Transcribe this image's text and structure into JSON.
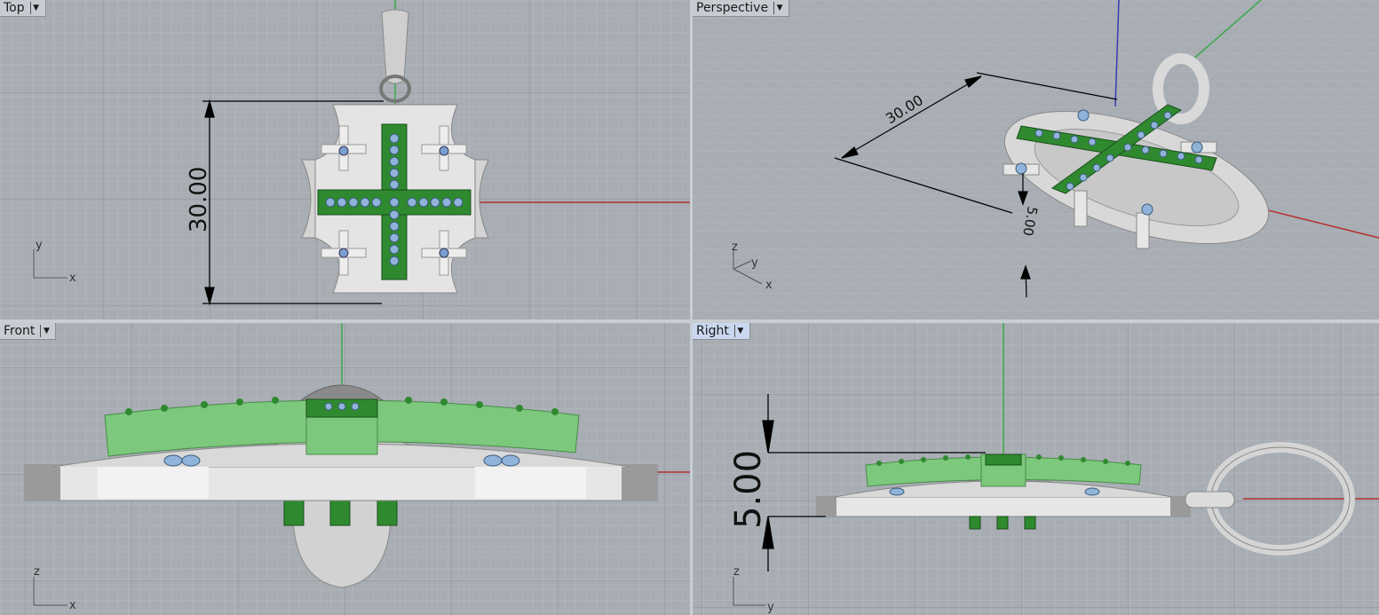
{
  "viewports": {
    "top": {
      "label": "Top",
      "dimension": "30.00",
      "axis_h": "x",
      "axis_v": "y",
      "active": false
    },
    "perspective": {
      "label": "Perspective",
      "dimension_a": "30.00",
      "dimension_b": "5.00",
      "axis_h": "x",
      "axis_v": "z",
      "axis_d": "y",
      "active": false
    },
    "front": {
      "label": "Front",
      "axis_h": "x",
      "axis_v": "z",
      "active": false
    },
    "right": {
      "label": "Right",
      "dimension": "5.00",
      "axis_h": "y",
      "axis_v": "z",
      "active": true
    }
  },
  "icons": {
    "dropdown": "chevron-down-icon"
  },
  "colors": {
    "viewport_bg": "#a7adb3",
    "grid_minor": "#b3b8be",
    "grid_major": "#8e949a",
    "x_axis": "#b5302c",
    "y_axis": "#3aa84a",
    "z_axis": "#3a3ab5",
    "silver": "#dcdcdc",
    "green": "#2f8a2f",
    "light_green": "#7cc87c",
    "gem": "#8fb3d9"
  }
}
